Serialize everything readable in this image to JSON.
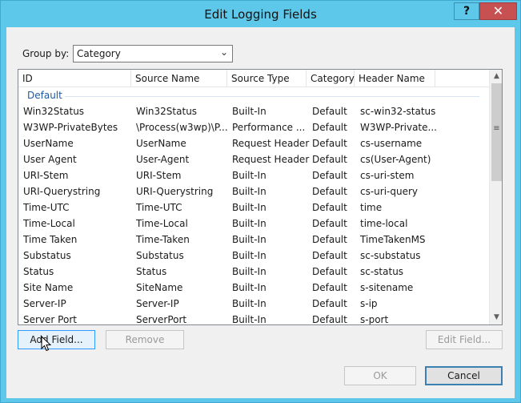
{
  "window": {
    "title": "Edit Logging Fields",
    "help_glyph": "?",
    "close_glyph": "✕"
  },
  "group_by": {
    "label": "Group by:",
    "value": "Category",
    "arrow": "⌄"
  },
  "list": {
    "columns": [
      "ID",
      "Source Name",
      "Source Type",
      "Category",
      "Header Name"
    ],
    "group_label": "Default",
    "rows": [
      [
        "Win32Status",
        "Win32Status",
        "Built-In",
        "Default",
        "sc-win32-status"
      ],
      [
        "W3WP-PrivateBytes",
        "\\Process(w3wp)\\P...",
        "Performance ...",
        "Default",
        "W3WP-Private..."
      ],
      [
        "UserName",
        "UserName",
        "Request Header",
        "Default",
        "cs-username"
      ],
      [
        "User Agent",
        "User-Agent",
        "Request Header",
        "Default",
        "cs(User-Agent)"
      ],
      [
        "URI-Stem",
        "URI-Stem",
        "Built-In",
        "Default",
        "cs-uri-stem"
      ],
      [
        "URI-Querystring",
        "URI-Querystring",
        "Built-In",
        "Default",
        "cs-uri-query"
      ],
      [
        "Time-UTC",
        "Time-UTC",
        "Built-In",
        "Default",
        "time"
      ],
      [
        "Time-Local",
        "Time-Local",
        "Built-In",
        "Default",
        "time-local"
      ],
      [
        "Time Taken",
        "Time-Taken",
        "Built-In",
        "Default",
        "TimeTakenMS"
      ],
      [
        "Substatus",
        "Substatus",
        "Built-In",
        "Default",
        "sc-substatus"
      ],
      [
        "Status",
        "Status",
        "Built-In",
        "Default",
        "sc-status"
      ],
      [
        "Site Name",
        "SiteName",
        "Built-In",
        "Default",
        "s-sitename"
      ],
      [
        "Server-IP",
        "Server-IP",
        "Built-In",
        "Default",
        "s-ip"
      ],
      [
        "Server Port",
        "ServerPort",
        "Built-In",
        "Default",
        "s-port"
      ]
    ],
    "scrollbar": {
      "up_glyph": "▲",
      "down_glyph": "▼",
      "grip_glyph": "≡"
    }
  },
  "buttons": {
    "add_field": "Add Field...",
    "remove": "Remove",
    "edit_field": "Edit Field...",
    "ok": "OK",
    "cancel": "Cancel"
  },
  "icons": {
    "help": "question-mark-icon",
    "close": "close-icon",
    "dropdown": "chevron-down-icon",
    "cursor": "mouse-pointer-icon"
  },
  "colors": {
    "titlebar": "#5ec8ea",
    "close_button": "#c75050",
    "group_label": "#1e5a9e",
    "button_hover": "#e5f1fb"
  }
}
